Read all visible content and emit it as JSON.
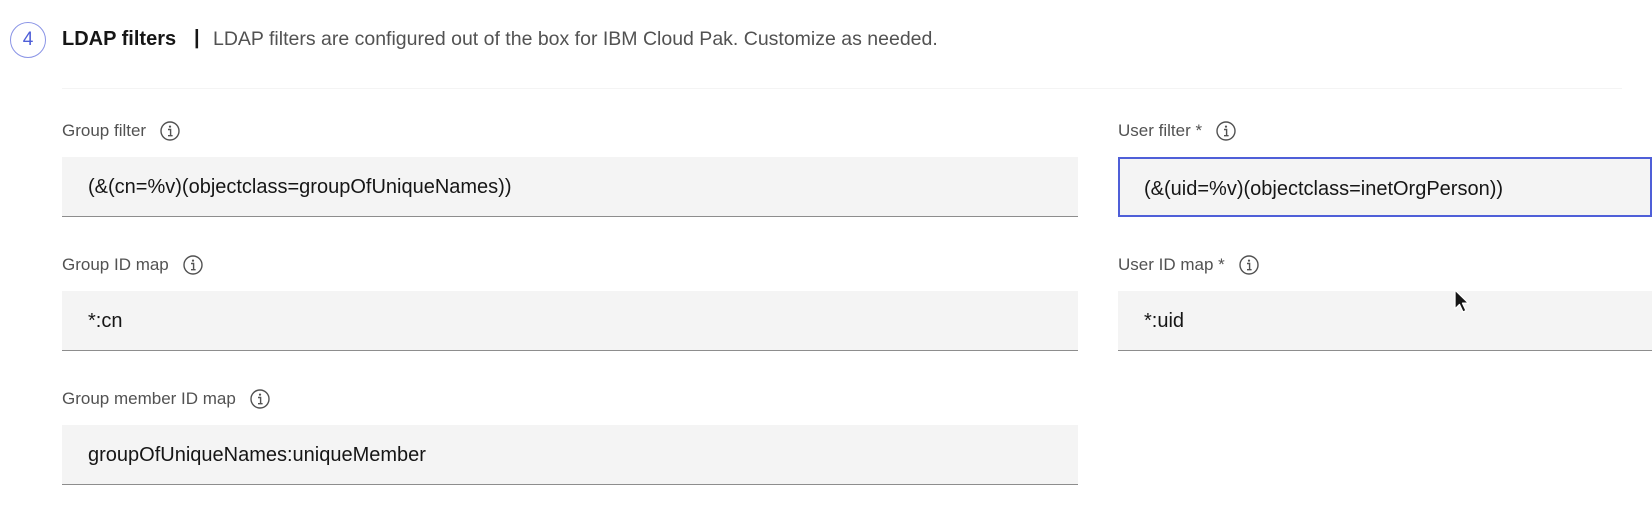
{
  "section": {
    "step_number": "4",
    "title": "LDAP filters",
    "separator": "|",
    "description": "LDAP filters are configured out of the box for IBM Cloud Pak. Customize as needed."
  },
  "fields": {
    "group_filter": {
      "label": "Group filter",
      "value": "(&(cn=%v)(objectclass=groupOfUniqueNames))",
      "icon": "info-icon"
    },
    "user_filter": {
      "label": "User filter *",
      "value": "(&(uid=%v)(objectclass=inetOrgPerson))",
      "icon": "info-icon",
      "focused": true
    },
    "group_id_map": {
      "label": "Group ID map",
      "value": "*:cn",
      "icon": "info-icon"
    },
    "user_id_map": {
      "label": "User ID map *",
      "value": "*:uid",
      "icon": "info-icon"
    },
    "group_member_id_map": {
      "label": "Group member ID map",
      "value": "groupOfUniqueNames:uniqueMember",
      "icon": "info-icon"
    }
  },
  "colors": {
    "accent": "#4f5fd8",
    "field_bg": "#f4f4f4",
    "label": "#525252",
    "text": "#161616"
  }
}
